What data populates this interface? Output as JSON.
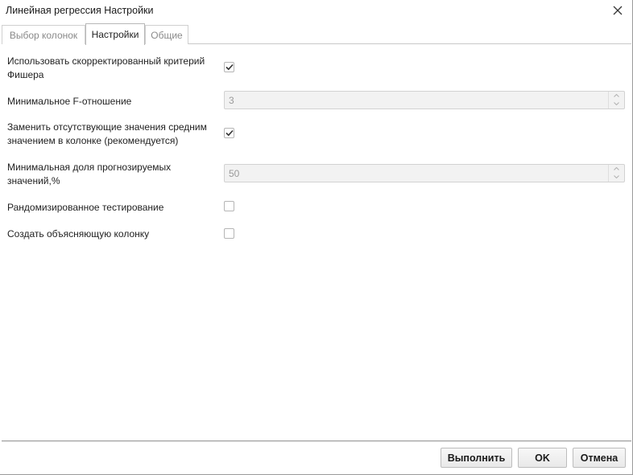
{
  "window": {
    "title": "Линейная регрессия Настройки",
    "close_icon": "close-icon"
  },
  "tabs": [
    {
      "label": "Выбор колонок",
      "active": false
    },
    {
      "label": "Настройки",
      "active": true
    },
    {
      "label": "Общие",
      "active": false
    }
  ],
  "settings": {
    "fisher": {
      "label_line1": "Использовать скорректированный критерий",
      "label_line2": "Фишера",
      "checked": true
    },
    "min_f": {
      "label": "Минимальное F-отношение",
      "value": "3"
    },
    "replace_missing": {
      "label_line1": "Заменить отсутствующие значения средним",
      "label_line2": "значением в колонке (рекомендуется)",
      "checked": true
    },
    "min_share": {
      "label_line1": "Минимальная доля прогнозируемых",
      "label_line2": "значений,%",
      "value": "50"
    },
    "randomized": {
      "label": "Рандомизированное тестирование",
      "checked": false
    },
    "explain_column": {
      "label": "Создать объясняющую колонку",
      "checked": false
    }
  },
  "buttons": {
    "run": "Выполнить",
    "ok": "OK",
    "cancel": "Отмена"
  },
  "colors": {
    "check": "#333333",
    "disabled_field_bg": "#f2f2f2"
  }
}
